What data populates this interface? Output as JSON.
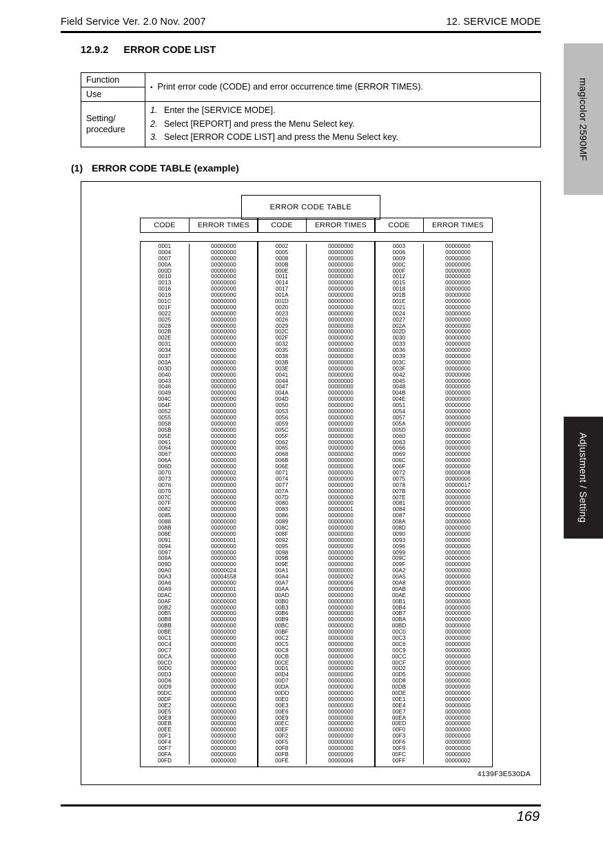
{
  "header": {
    "left": "Field Service Ver. 2.0 Nov. 2007",
    "right": "12. SERVICE MODE"
  },
  "section": {
    "number": "12.9.2",
    "title": "ERROR CODE LIST"
  },
  "spec_table": {
    "function_label": "Function",
    "use_label": "Use",
    "function_text": "Print error code (CODE) and error occurrence time (ERROR TIMES).",
    "bullet": "•",
    "procedure_label_line1": "Setting/",
    "procedure_label_line2": "procedure",
    "procedure_steps": [
      {
        "num": "1.",
        "text": "Enter the [SERVICE MODE]."
      },
      {
        "num": "2.",
        "text": "Select [REPORT] and press the Menu Select key."
      },
      {
        "num": "3.",
        "text": "Select [ERROR CODE LIST] and press the Menu Select key."
      }
    ]
  },
  "subsection": {
    "number": "(1)",
    "title": "ERROR CODE TABLE (example)"
  },
  "figure": {
    "title_box": "ERROR CODE TABLE",
    "column_headers": {
      "code": "CODE",
      "error_times": "ERROR TIMES"
    },
    "figure_id": "4139F3E530DA",
    "default_error_times": "00000000",
    "row_count_per_column": 85,
    "column_start_codes": [
      1,
      2,
      3
    ],
    "code_step": 3,
    "nonzero_error_times": {
      "0070": "00000002",
      "0072": "00000008",
      "0078": "00000017",
      "0083": "00000001",
      "0091": "00000001",
      "00A0": "00000024",
      "00A3": "00004558",
      "00A4": "00000002",
      "00A7": "00000006",
      "00A9": "00000001",
      "00FE": "00000006",
      "00FF": "00000002"
    }
  },
  "side_tabs": {
    "product": "magicolor 2590MF",
    "chapter": "Adjustment / Setting"
  },
  "footer": {
    "page_number": "169"
  }
}
